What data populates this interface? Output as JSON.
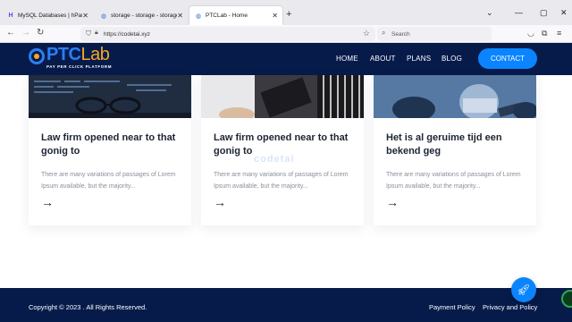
{
  "browser": {
    "tabs": [
      {
        "title": "MySQL Databases | hPanel",
        "icon": "hpanel-icon"
      },
      {
        "title": "storage - storage - storage - sto",
        "icon": "globe-icon"
      },
      {
        "title": "PTCLab - Home",
        "icon": "globe-icon"
      }
    ],
    "url": "https://codetai.xyz",
    "search_placeholder": "Search"
  },
  "header": {
    "logo_main": "PTC",
    "logo_accent": "Lab",
    "logo_tagline": "PAY PER CLICK PLATFORM",
    "menu": [
      "HOME",
      "ABOUT",
      "PLANS",
      "BLOG"
    ],
    "contact_label": "CONTACT",
    "colors": {
      "navy": "#071b4b",
      "accent": "#0a84ff",
      "orange": "#f6a623"
    }
  },
  "cards": [
    {
      "title": "Law firm opened near to that gonig to",
      "text": "There are many variations of passages of Lorem Ipsum available, but the majority..."
    },
    {
      "title": "Law firm opened near to that gonig to",
      "text": "There are many variations of passages of Lorem Ipsum available, but the majority..."
    },
    {
      "title": "Het is al geruime tijd een bekend geg",
      "text": "There are many variations of passages of Lorem Ipsum available, but the majority..."
    }
  ],
  "watermark": "codetai",
  "footer": {
    "copyright": "Copyright © 2023 . All Rights Reserved.",
    "links": [
      "Payment Policy",
      "Privacy and Policy"
    ]
  }
}
